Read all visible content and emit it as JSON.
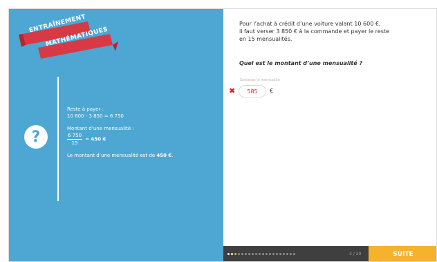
{
  "colors": {
    "left_panel": "#4ea7d3",
    "banner": "#d73a44",
    "wrong": "#d5232f",
    "next_button": "#f4b22d",
    "bottom_bar": "#3f3f3f",
    "current_dot": "#f5b10a"
  },
  "banner": {
    "line1": "ENTRAÎNEMENT",
    "line2": "MATHÉMATIQUES"
  },
  "help_icon": {
    "glyph": "?",
    "name": "help-icon"
  },
  "explanation": {
    "line1": "Reste à payer :",
    "line2": "10 600 - 3 850 = 6 750",
    "line3": "Montant d’une mensualité :",
    "fraction_numerator": "6 750",
    "fraction_denominator": "15",
    "fraction_equals": "=",
    "fraction_result": "450 €",
    "conclusion_prefix": "Le montant d’une mensualité est de ",
    "conclusion_value": "450 €",
    "conclusion_suffix": "."
  },
  "question": {
    "text_line1": "Pour l’achat à crédit d’une voiture valant 10 600 €,",
    "text_line2": "il faut verser 3 850 € à la commande et payer le reste",
    "text_line3": "en 15 mensualités.",
    "title": "Quel est le montant d’une mensualité ?",
    "input_label": "Saisissez la mensualité",
    "answer_value": "585",
    "unit": "€",
    "wrong_icon": "✖"
  },
  "navigation": {
    "progress": "3 / 20",
    "next_label": "SUITE"
  }
}
